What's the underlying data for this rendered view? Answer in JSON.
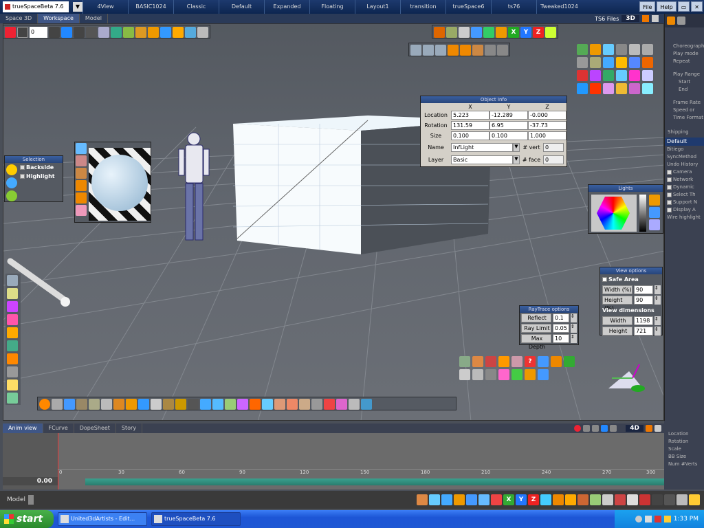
{
  "topbar": {
    "app_title": "trueSpaceBeta 7.6",
    "menus": [
      "4View",
      "BASIC1024",
      "Classic",
      "Default",
      "Expanded",
      "Floating",
      "Layout1",
      "transition",
      "trueSpace6",
      "ts76",
      "Tweaked1024"
    ],
    "buttons": {
      "file": "File",
      "help": "Help"
    }
  },
  "bar2": {
    "tabs": [
      "Space 3D",
      "Workspace",
      "Model"
    ],
    "ts6_label": "TS6 Files",
    "view_label": "3D",
    "frame_value": "0"
  },
  "object_info": {
    "title": "Object Info",
    "col_x": "X",
    "col_y": "Y",
    "col_z": "Z",
    "rows": [
      {
        "label": "Location",
        "x": "5.223",
        "y": "-12.289",
        "z": "-0.000"
      },
      {
        "label": "Rotation",
        "x": "131.59",
        "y": "6.95",
        "z": "-37.73"
      },
      {
        "label": "Size",
        "x": "0.100",
        "y": "0.100",
        "z": "1.000"
      }
    ],
    "name_label": "Name",
    "name_value": "InfLight",
    "vert_label": "# vert",
    "vert_value": "0",
    "layer_label": "Layer",
    "layer_value": "Basic",
    "face_label": "# face",
    "face_value": "0"
  },
  "selection": {
    "title": "Selection",
    "backside": "Backside",
    "highlight": "Highlight"
  },
  "lights": {
    "title": "Lights"
  },
  "view_options": {
    "title": "View options",
    "safe_area": "Safe Area",
    "width_pct_label": "Width (%)",
    "width_pct": "90",
    "height_pct_label": "Height (%)",
    "height_pct": "90",
    "dims_label": "View dimensions",
    "width_label": "Width",
    "width": "1198",
    "height_label": "Height",
    "height": "721"
  },
  "raytrace": {
    "title": "RayTrace options",
    "reflect_label": "Reflect",
    "reflect": "0.1",
    "ray_limit_label": "Ray Limit",
    "ray_limit": "0.05",
    "max_depth_label": "Max Depth",
    "max_depth": "10"
  },
  "right_panel": {
    "top_items": [
      "Choreography",
      "Play mode",
      "Repeat",
      "Play Range",
      "Start",
      "End",
      "Frame Rate",
      "Speed or",
      "Time Format"
    ],
    "shipping": "Shipping",
    "default_label": "Default",
    "list_items": [
      "Bitiego",
      "SyncMethod",
      "Undo History"
    ],
    "check_items": [
      "Camera",
      "Network",
      "Dynamic",
      "Select Th",
      "Support N",
      "Display A"
    ],
    "last_item": "Wire highlight",
    "bottom_items": [
      "Location",
      "Rotation",
      "Scale",
      "BB Size",
      "Num #Verts"
    ]
  },
  "anim": {
    "tabs": [
      "Anim view",
      "FCurve",
      "DopeSheet",
      "Story"
    ],
    "time": "0.00",
    "view_label": "4D",
    "ticks": [
      "0",
      "30",
      "60",
      "90",
      "120",
      "150",
      "180",
      "210",
      "240",
      "270",
      "300"
    ]
  },
  "model_bar": {
    "label": "Model"
  },
  "taskbar": {
    "start": "start",
    "tasks": [
      "United3dArtists - Edit...",
      "trueSpaceBeta 7.6"
    ],
    "clock": "1:33 PM"
  },
  "colors": {
    "accent": "#27457a",
    "panel": "#d4d0c8",
    "taskbar": "#1f57d3"
  }
}
